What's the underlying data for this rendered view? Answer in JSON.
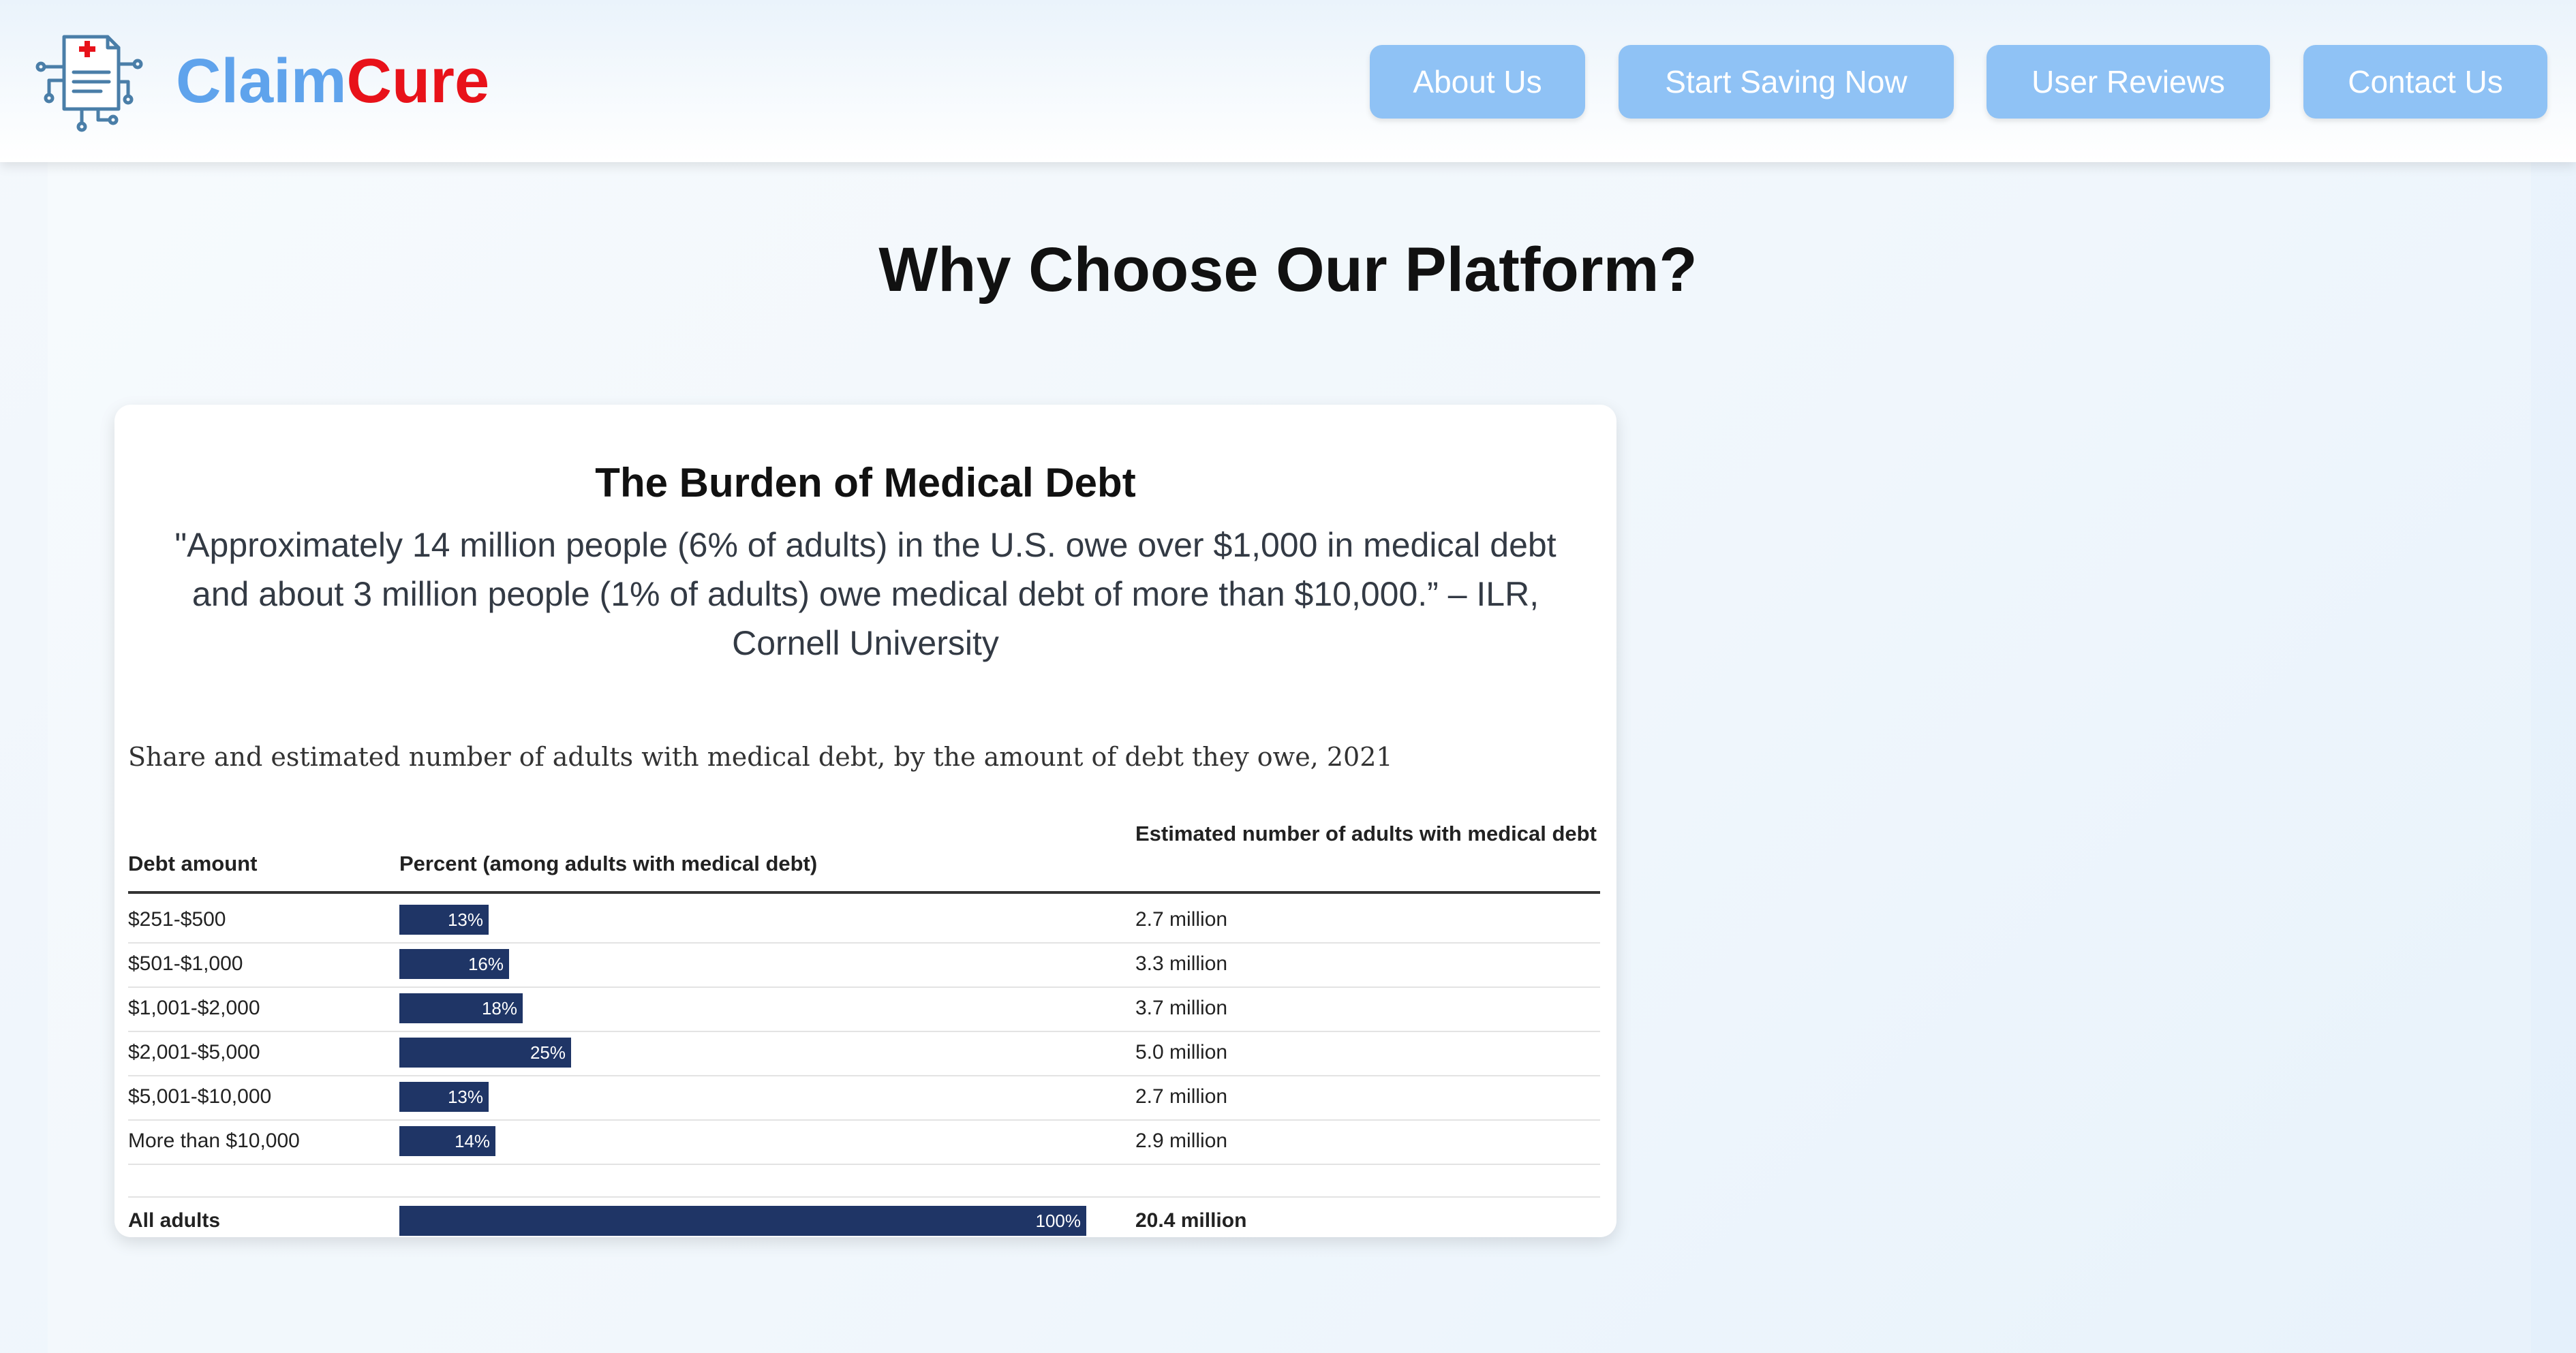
{
  "header": {
    "brand_part1": "Claim",
    "brand_part2": "Cure",
    "nav": [
      {
        "label": "About Us"
      },
      {
        "label": "Start Saving Now"
      },
      {
        "label": "User Reviews"
      },
      {
        "label": "Contact Us"
      }
    ]
  },
  "main": {
    "section_title": "Why Choose Our Platform?",
    "card": {
      "title": "The Burden of Medical Debt",
      "quote": "\"Approximately 14 million people (6% of adults) in the U.S. owe over $1,000 in medical debt and about 3 million people (1% of adults) owe medical debt of more than $10,000.” – ILR, Cornell University",
      "table_caption": "Share and estimated number of adults with medical debt, by the amount of debt they owe, 2021",
      "columns": {
        "debt": "Debt amount",
        "percent": "Percent (among adults with medical debt)",
        "estimated": "Estimated number of adults with medical debt"
      },
      "rows": [
        {
          "debt": "$251-$500",
          "percent_label": "13%",
          "percent": 13,
          "estimated": "2.7 million"
        },
        {
          "debt": "$501-$1,000",
          "percent_label": "16%",
          "percent": 16,
          "estimated": "3.3 million"
        },
        {
          "debt": "$1,001-$2,000",
          "percent_label": "18%",
          "percent": 18,
          "estimated": "3.7 million"
        },
        {
          "debt": "$2,001-$5,000",
          "percent_label": "25%",
          "percent": 25,
          "estimated": "5.0 million"
        },
        {
          "debt": "$5,001-$10,000",
          "percent_label": "13%",
          "percent": 13,
          "estimated": "2.7 million"
        },
        {
          "debt": "More than $10,000",
          "percent_label": "14%",
          "percent": 14,
          "estimated": "2.9 million"
        }
      ],
      "total": {
        "debt": "All adults",
        "percent_label": "100%",
        "percent": 100,
        "estimated": "20.4 million"
      }
    }
  },
  "colors": {
    "brand_blue": "#5fa3ec",
    "brand_red": "#e8121a",
    "nav_button": "#8fc2f5",
    "bar": "#1f3566"
  },
  "icons": {
    "logo": "medical-document-circuit-icon"
  }
}
